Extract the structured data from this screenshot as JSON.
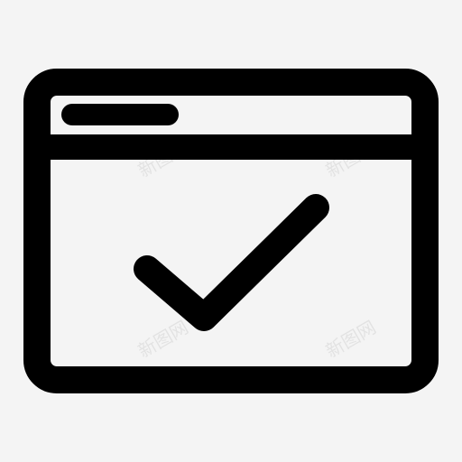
{
  "icon": {
    "name": "browser-window-checkmark-icon",
    "stroke_color": "#000000",
    "background_color": "#f4f4f4"
  },
  "watermark": {
    "text": "新图网"
  }
}
